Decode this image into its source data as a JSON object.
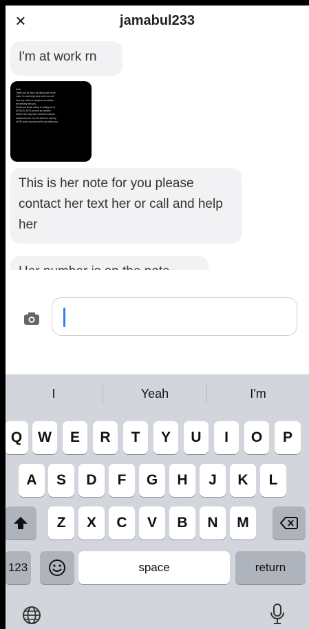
{
  "header": {
    "title": "jamabul233",
    "close_icon": "×"
  },
  "messages": [
    {
      "text": "I'm at work rn"
    },
    {
      "type": "image",
      "note_lines": [
        "Hello,",
        "Thank you so much for taking care of my",
        "order. I'm currently not at home and will",
        "have my mother's caregiver coordinate",
        "the delivery with you.",
        "Would you kindly calling or texting her at",
        "(479) 612-4675 as soon as possible.",
        "believe she may have wanted to include",
        "additional items. I've left behind a cash tip",
        "of $30 under my doormat for you thank you."
      ]
    },
    {
      "text": "This is her note for you please contact her text her or call and help her"
    },
    {
      "text": "Her number is on the note"
    }
  ],
  "composer": {
    "placeholder": ""
  },
  "keyboard": {
    "suggestions": [
      "I",
      "Yeah",
      "I'm"
    ],
    "row1": [
      "Q",
      "W",
      "E",
      "R",
      "T",
      "Y",
      "U",
      "I",
      "O",
      "P"
    ],
    "row2": [
      "A",
      "S",
      "D",
      "F",
      "G",
      "H",
      "J",
      "K",
      "L"
    ],
    "row3": [
      "Z",
      "X",
      "C",
      "V",
      "B",
      "N",
      "M"
    ],
    "numbers_label": "123",
    "space_label": "space",
    "return_label": "return"
  }
}
